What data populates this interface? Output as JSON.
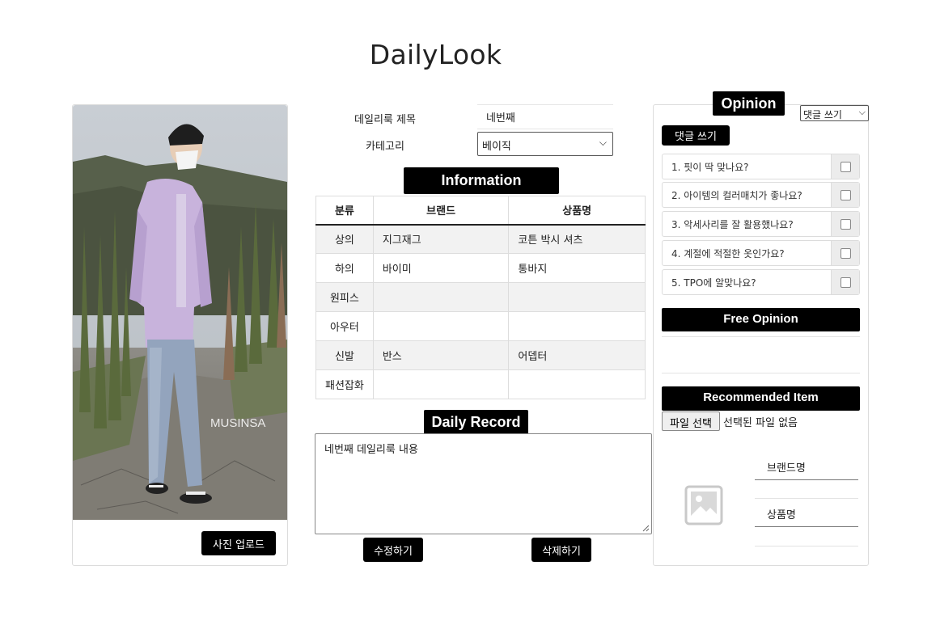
{
  "app": {
    "title": "DailyLook"
  },
  "photo": {
    "upload_label": "사진 업로드",
    "watermark": "MUSINSA"
  },
  "form": {
    "title_label": "데일리룩 제목",
    "title_value": "네번째",
    "category_label": "카테고리",
    "category_value": "베이직"
  },
  "information": {
    "header": "Information",
    "columns": [
      "분류",
      "브랜드",
      "상품명"
    ],
    "rows": [
      {
        "category": "상의",
        "brand": "지그재그",
        "product": "코튼 박시 셔츠"
      },
      {
        "category": "하의",
        "brand": "바이미",
        "product": "통바지"
      },
      {
        "category": "원피스",
        "brand": "",
        "product": ""
      },
      {
        "category": "아우터",
        "brand": "",
        "product": ""
      },
      {
        "category": "신발",
        "brand": "반스",
        "product": "어뎁터"
      },
      {
        "category": "패션잡화",
        "brand": "",
        "product": ""
      }
    ]
  },
  "record": {
    "header": "Daily Record",
    "content": "네번째 데일리룩 내용",
    "edit_label": "수정하기",
    "delete_label": "삭제하기"
  },
  "opinion": {
    "header": "Opinion",
    "select_value": "댓글 쓰기",
    "write_label": "댓글 쓰기",
    "questions": [
      "1. 핏이 딱 맞나요?",
      "2. 아이템의 컬러매치가 좋나요?",
      "3. 악세사리를 잘 활용했나요?",
      "4. 계절에 적절한 옷인가요?",
      "5. TPO에 알맞나요?"
    ],
    "free_header": "Free Opinion",
    "recommended_header": "Recommended Item",
    "file_button": "파일 선택",
    "file_status": "선택된 파일 없음",
    "brand_field": "브랜드명",
    "product_field": "상품명"
  },
  "colors": {
    "accent": "#000000",
    "row_alt": "#f2f2f2",
    "border": "#dcdcdc"
  }
}
